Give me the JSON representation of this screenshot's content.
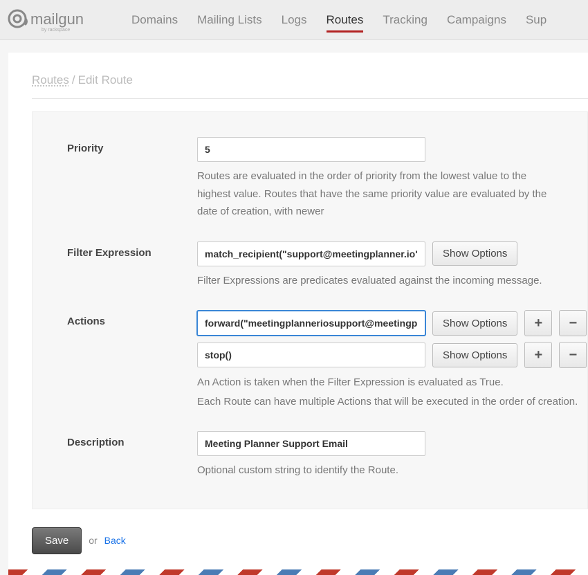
{
  "brand": "mailgun",
  "brand_sub": "by rackspace",
  "nav": [
    {
      "label": "Domains",
      "active": false
    },
    {
      "label": "Mailing Lists",
      "active": false
    },
    {
      "label": "Logs",
      "active": false
    },
    {
      "label": "Routes",
      "active": true
    },
    {
      "label": "Tracking",
      "active": false
    },
    {
      "label": "Campaigns",
      "active": false
    },
    {
      "label": "Sup",
      "active": false
    }
  ],
  "breadcrumb": {
    "root": "Routes",
    "current": "Edit Route"
  },
  "form": {
    "priority": {
      "label": "Priority",
      "value": "5",
      "help": "Routes are evaluated in the order of priority from the lowest value to the highest value. Routes that have the same priority value are evaluated by the date of creation, with newer"
    },
    "filter": {
      "label": "Filter Expression",
      "value": "match_recipient(\"support@meetingplanner.io\")",
      "show_options": "Show Options",
      "help": "Filter Expressions are predicates evaluated against the incoming message."
    },
    "actions": {
      "label": "Actions",
      "rows": [
        {
          "value": "forward(\"meetingplanneriosupport@meetingplanner.",
          "focused": true
        },
        {
          "value": "stop()",
          "focused": false
        }
      ],
      "show_options": "Show Options",
      "help1": "An Action is taken when the Filter Expression is evaluated as True.",
      "help2": "Each Route can have multiple Actions that will be executed in the order of creation."
    },
    "description": {
      "label": "Description",
      "value": "Meeting Planner Support Email",
      "help": "Optional custom string to identify the Route."
    }
  },
  "footer": {
    "save": "Save",
    "or": "or",
    "back": "Back"
  },
  "icons": {
    "plus": "+",
    "minus": "−"
  }
}
